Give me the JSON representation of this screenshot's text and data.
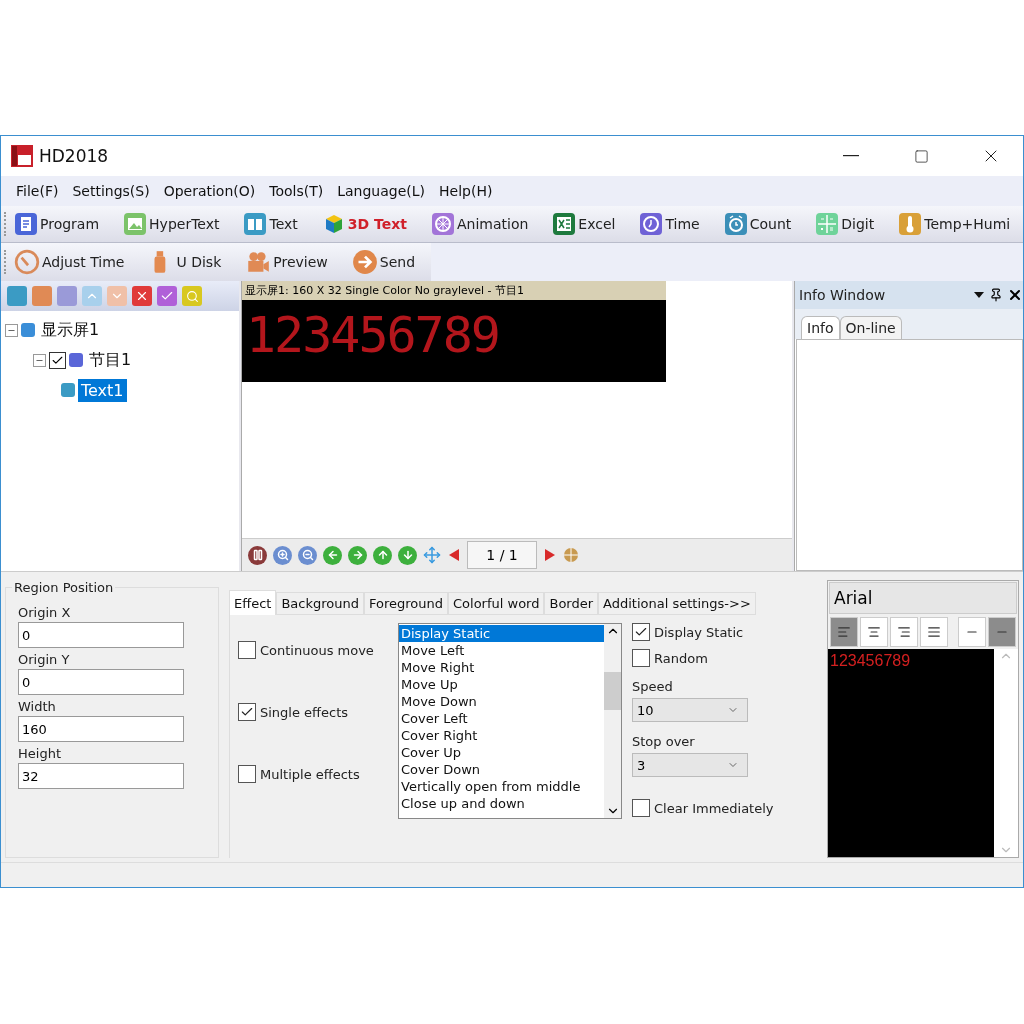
{
  "window": {
    "title": "HD2018"
  },
  "menu": [
    "File(F)",
    "Settings(S)",
    "Operation(O)",
    "Tools(T)",
    "Language(L)",
    "Help(H)"
  ],
  "toolbar": [
    {
      "label": "Program",
      "highlighted": false
    },
    {
      "label": "HyperText",
      "highlighted": false
    },
    {
      "label": "Text",
      "highlighted": false
    },
    {
      "label": "3D Text",
      "highlighted": true
    },
    {
      "label": "Animation",
      "highlighted": false
    },
    {
      "label": "Excel",
      "highlighted": false
    },
    {
      "label": "Time",
      "highlighted": false
    },
    {
      "label": "Count",
      "highlighted": false
    },
    {
      "label": "Digit",
      "highlighted": false
    },
    {
      "label": "Temp+Humi",
      "highlighted": false
    }
  ],
  "toolbar2": [
    "Adjust Time",
    "U Disk",
    "Preview",
    "Send"
  ],
  "tree": [
    {
      "label": "显示屏1",
      "kind": "screen",
      "expanded": true,
      "children": [
        {
          "label": "节目1",
          "kind": "program",
          "checked": true,
          "expanded": true,
          "children": [
            {
              "label": "Text1",
              "kind": "text",
              "selected": true
            }
          ]
        }
      ]
    }
  ],
  "preview": {
    "header": "显示屏1: 160 X 32  Single Color No graylevel - 节目1",
    "display_text": "123456789",
    "page": "1 / 1"
  },
  "info_window": {
    "title": "Info Window",
    "tabs": [
      {
        "label": "Info",
        "selected": true
      },
      {
        "label": "On-line",
        "selected": false
      }
    ]
  },
  "region_position": {
    "title": "Region Position",
    "fields": [
      {
        "label": "Origin X",
        "value": "0"
      },
      {
        "label": "Origin Y",
        "value": "0"
      },
      {
        "label": "Width",
        "value": "160"
      },
      {
        "label": "Height",
        "value": "32"
      }
    ]
  },
  "settings_tabs": [
    {
      "label": "Effect",
      "selected": true
    },
    {
      "label": "Background",
      "selected": false
    },
    {
      "label": "Foreground",
      "selected": false
    },
    {
      "label": "Colorful word",
      "selected": false
    },
    {
      "label": "Border",
      "selected": false
    },
    {
      "label": "Additional settings->>",
      "selected": false
    }
  ],
  "effect_modes": [
    {
      "label": "Continuous move",
      "checked": false
    },
    {
      "label": "Single effects",
      "checked": true
    },
    {
      "label": "Multiple effects",
      "checked": false
    }
  ],
  "effects_list": [
    {
      "label": "Display Static",
      "selected": true
    },
    {
      "label": "Move Left",
      "selected": false
    },
    {
      "label": "Move Right",
      "selected": false
    },
    {
      "label": "Move Up",
      "selected": false
    },
    {
      "label": "Move Down",
      "selected": false
    },
    {
      "label": "Cover Left",
      "selected": false
    },
    {
      "label": "Cover Right",
      "selected": false
    },
    {
      "label": "Cover Up",
      "selected": false
    },
    {
      "label": "Cover Down",
      "selected": false
    },
    {
      "label": "Vertically open from middle",
      "selected": false
    },
    {
      "label": "Close up and down",
      "selected": false
    }
  ],
  "effect_options": [
    {
      "kind": "checkbox",
      "label": "Display Static",
      "checked": true
    },
    {
      "kind": "checkbox",
      "label": "Random",
      "checked": false
    },
    {
      "kind": "select",
      "label": "Speed",
      "value": "10"
    },
    {
      "kind": "select",
      "label": "Stop over",
      "value": "3"
    },
    {
      "kind": "checkbox",
      "label": "Clear Immediately",
      "checked": false
    }
  ],
  "text_editor": {
    "font": "Arial",
    "alignments": [
      {
        "selected": true
      },
      {
        "selected": false
      },
      {
        "selected": false
      },
      {
        "selected": false
      },
      {
        "selected": false
      },
      {
        "selected": true
      }
    ],
    "content": "123456789"
  }
}
